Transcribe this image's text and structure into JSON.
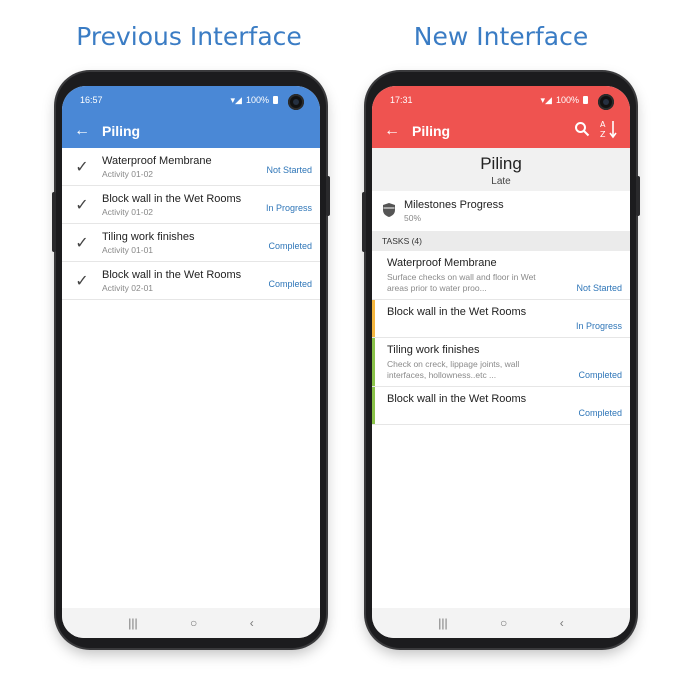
{
  "captions": {
    "left": "Previous Interface",
    "right": "New Interface"
  },
  "colors": {
    "previous_accent": "#4a88d6",
    "new_accent": "#ef5350",
    "status_link": "#2f76b8",
    "bar_yellow": "#f4b63f",
    "bar_green": "#8bc34a"
  },
  "previous": {
    "status": {
      "time": "16:57",
      "battery": "100%"
    },
    "appbar": {
      "back_icon": "arrow-left-icon",
      "title": "Piling"
    },
    "items": [
      {
        "title": "Waterproof Membrane",
        "sub": "Activity 01-02",
        "status": "Not Started"
      },
      {
        "title": "Block wall in the Wet Rooms",
        "sub": "Activity 01-02",
        "status": "In Progress"
      },
      {
        "title": "Tiling work finishes",
        "sub": "Activity 01-01",
        "status": "Completed"
      },
      {
        "title": "Block wall in the Wet Rooms",
        "sub": "Activity 02-01",
        "status": "Completed"
      }
    ]
  },
  "new": {
    "status": {
      "time": "17:31",
      "battery": "100%"
    },
    "appbar": {
      "back_icon": "arrow-left-icon",
      "title": "Piling",
      "search_icon": "search-icon",
      "sort_icon": "sort-az-icon"
    },
    "header": {
      "title": "Piling",
      "subtitle": "Late"
    },
    "milestone": {
      "title": "Milestones Progress",
      "percent": "50%"
    },
    "tasks_heading": "TASKS (4)",
    "tasks": [
      {
        "title": "Waterproof Membrane",
        "desc": "Surface checks on wall and floor in Wet areas prior to water proo...",
        "status": "Not Started",
        "bar": "none"
      },
      {
        "title": "Block wall in the Wet Rooms",
        "desc": "",
        "status": "In Progress",
        "bar": "yellow"
      },
      {
        "title": "Tiling work finishes",
        "desc": "Check on creck, lippage joints, wall interfaces, hollowness..etc ...",
        "status": "Completed",
        "bar": "green"
      },
      {
        "title": "Block wall in the Wet Rooms",
        "desc": "",
        "status": "Completed",
        "bar": "green"
      }
    ]
  }
}
